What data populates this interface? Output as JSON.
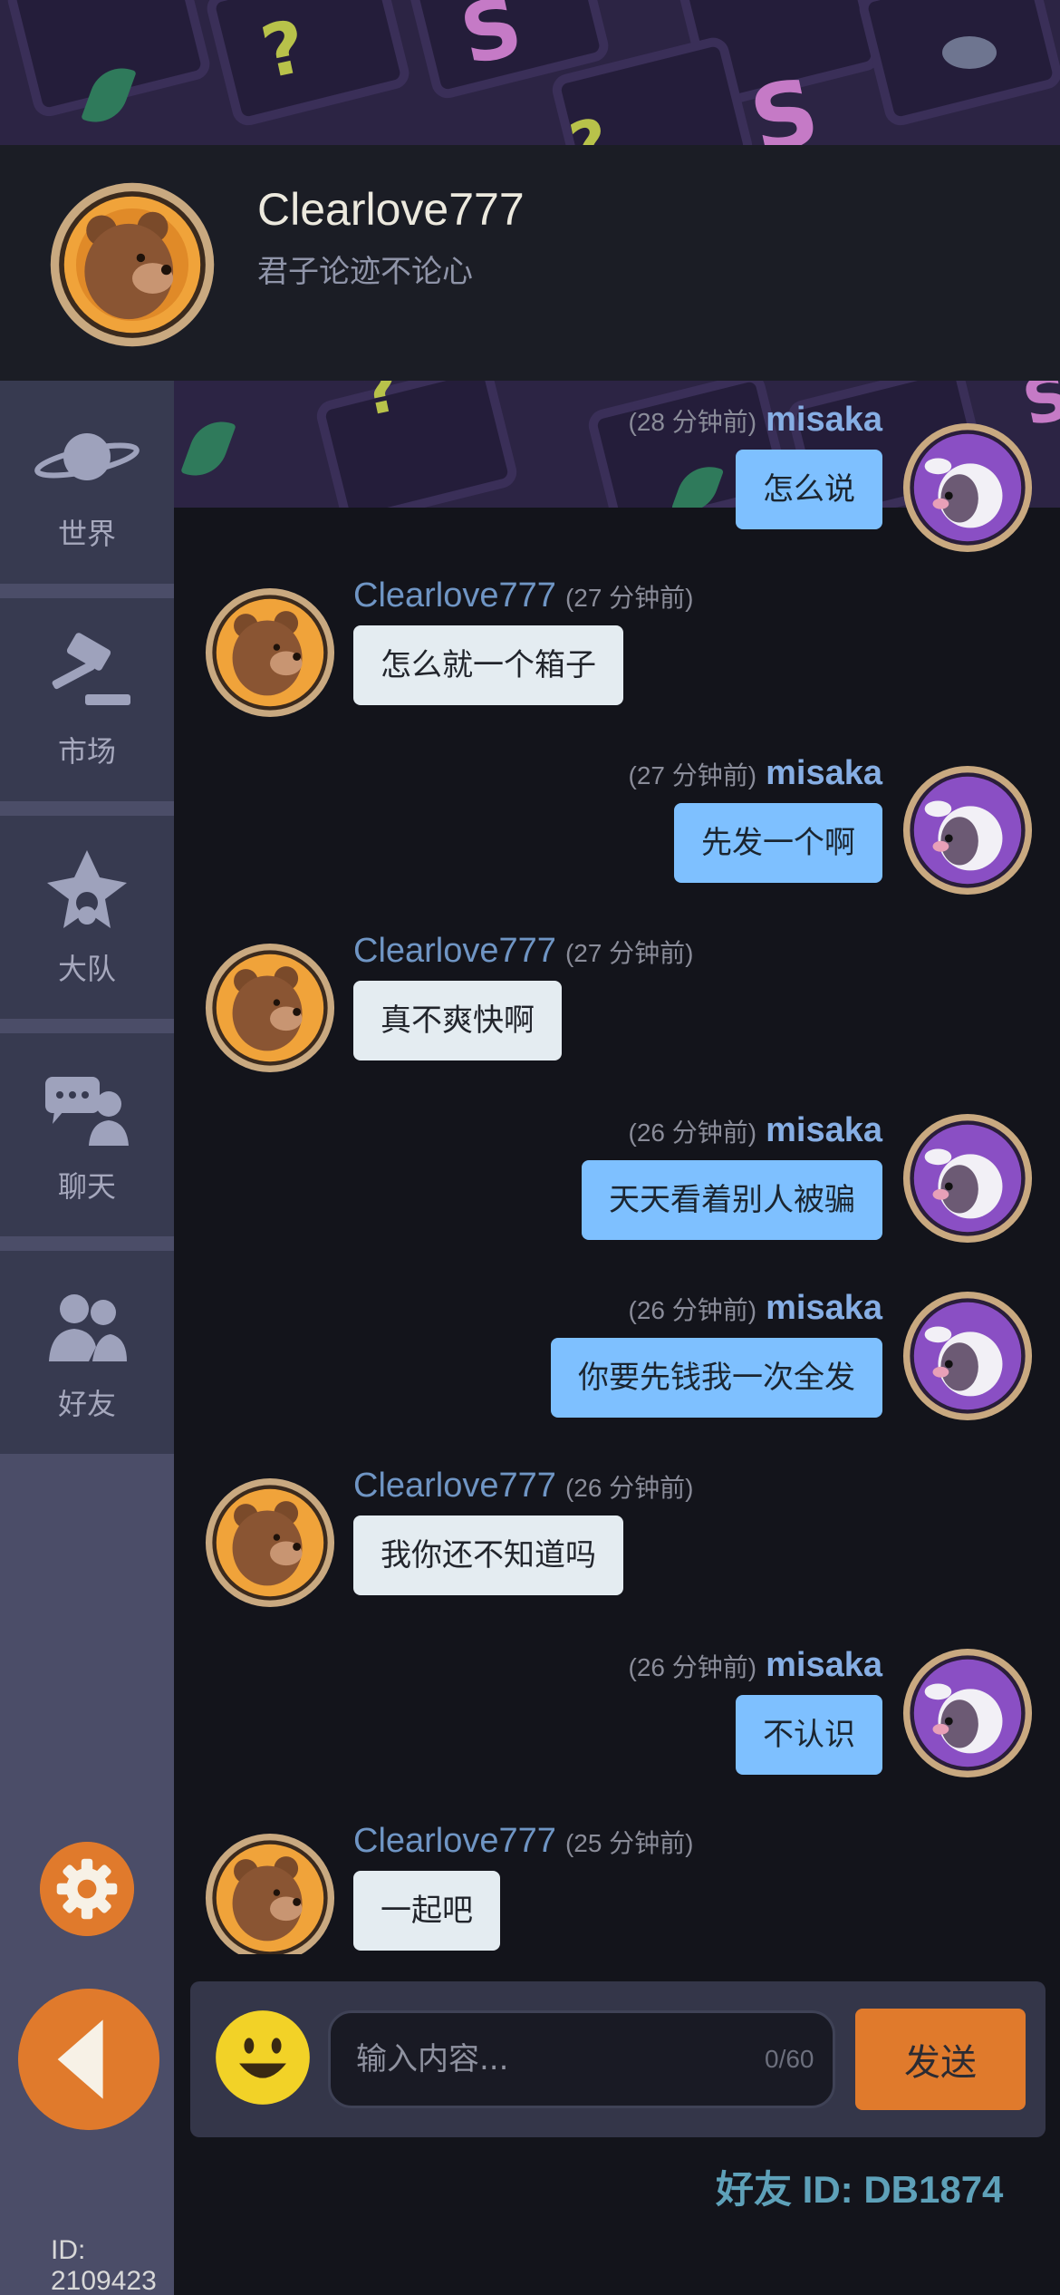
{
  "colors": {
    "accent_orange": "#e07a2c",
    "bubble_self": "#7ec0ff",
    "bubble_other": "#e4ecf1",
    "sidebar": "#373a50",
    "background": "#13141b"
  },
  "header": {
    "name": "Clearlove777",
    "motto": "君子论迹不论心",
    "avatar": "bear-avatar"
  },
  "sidebar": {
    "items": [
      {
        "label": "世界",
        "icon": "planet-icon"
      },
      {
        "label": "市场",
        "icon": "gavel-icon"
      },
      {
        "label": "大队",
        "icon": "guild-emblem-icon"
      },
      {
        "label": "聊天",
        "icon": "chat-icon"
      },
      {
        "label": "好友",
        "icon": "friends-icon"
      }
    ],
    "settings_icon": "gear-icon",
    "back_icon": "back-arrow-icon",
    "user_id": "ID: 2109423"
  },
  "messages": [
    {
      "side": "right",
      "name": "misaka",
      "time": "(28 分钟前)",
      "text": "怎么说"
    },
    {
      "side": "left",
      "name": "Clearlove777",
      "time": "(27 分钟前)",
      "text": "怎么就一个箱子"
    },
    {
      "side": "right",
      "name": "misaka",
      "time": "(27 分钟前)",
      "text": "先发一个啊"
    },
    {
      "side": "left",
      "name": "Clearlove777",
      "time": "(27 分钟前)",
      "text": "真不爽快啊"
    },
    {
      "side": "right",
      "name": "misaka",
      "time": "(26 分钟前)",
      "text": "天天看着别人被骗"
    },
    {
      "side": "right",
      "name": "misaka",
      "time": "(26 分钟前)",
      "text": "你要先钱我一次全发"
    },
    {
      "side": "left",
      "name": "Clearlove777",
      "time": "(26 分钟前)",
      "text": "我你还不知道吗"
    },
    {
      "side": "right",
      "name": "misaka",
      "time": "(26 分钟前)",
      "text": "不认识"
    },
    {
      "side": "left",
      "name": "Clearlove777",
      "time": "(25 分钟前)",
      "text": "一起吧"
    }
  ],
  "input": {
    "placeholder": "输入内容...",
    "value": "",
    "char_count": "0/60",
    "send_label": "发送",
    "emoji_icon": "smiley-icon"
  },
  "friend_id": "好友 ID: DB1874"
}
